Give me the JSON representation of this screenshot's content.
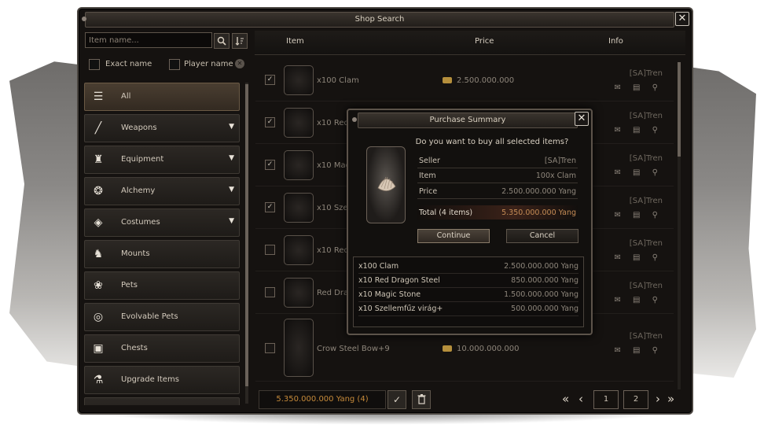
{
  "window": {
    "title": "Shop Search",
    "close_glyph": "✕"
  },
  "search": {
    "placeholder": "Item name...",
    "search_icon": "search-icon",
    "sort_icon": "sort-icon"
  },
  "filters": {
    "exact_name": "Exact name",
    "player_name": "Player name",
    "clear_glyph": "✕"
  },
  "categories": [
    {
      "label": "All",
      "icon": "☰",
      "arrow": "",
      "active": true
    },
    {
      "label": "Weapons",
      "icon": "╱",
      "arrow": "▼"
    },
    {
      "label": "Equipment",
      "icon": "♜",
      "arrow": "▼"
    },
    {
      "label": "Alchemy",
      "icon": "❂",
      "arrow": "▼"
    },
    {
      "label": "Costumes",
      "icon": "◈",
      "arrow": "▼"
    },
    {
      "label": "Mounts",
      "icon": "♞",
      "arrow": ""
    },
    {
      "label": "Pets",
      "icon": "❀",
      "arrow": ""
    },
    {
      "label": "Evolvable Pets",
      "icon": "◎",
      "arrow": ""
    },
    {
      "label": "Chests",
      "icon": "▣",
      "arrow": ""
    },
    {
      "label": "Upgrade Items",
      "icon": "⚗",
      "arrow": ""
    }
  ],
  "columns": {
    "item": "Item",
    "price": "Price",
    "info": "Info"
  },
  "rows": [
    {
      "name": "x100 Clam",
      "price": "2.500.000.000",
      "seller": "[SA]Tren",
      "checked": "✓"
    },
    {
      "name": "x10 Red",
      "price": "",
      "seller": "[SA]Tren",
      "checked": "✓"
    },
    {
      "name": "x10 Mag",
      "price": "",
      "seller": "[SA]Tren",
      "checked": "✓"
    },
    {
      "name": "x10 Szell",
      "price": "",
      "seller": "[SA]Tren",
      "checked": "✓"
    },
    {
      "name": "x10 Red",
      "price": "",
      "seller": "[SA]Tren",
      "checked": ""
    },
    {
      "name": "Red Dra",
      "price": "",
      "seller": "[SA]Tren",
      "checked": ""
    },
    {
      "name": "Crow Steel Bow+9",
      "price": "10.000.000.000",
      "seller": "[SA]Tren",
      "checked": ""
    }
  ],
  "row_info_icons": "✉ ▤ ⚲",
  "footer": {
    "total": "5.350.000.000 Yang (4)",
    "confirm_glyph": "✓",
    "delete_glyph": "🗑",
    "first_glyph": "«",
    "prev_glyph": "‹",
    "pages": [
      "1",
      "2"
    ],
    "next_glyph": "›",
    "last_glyph": "»"
  },
  "dialog": {
    "title": "Purchase Summary",
    "question": "Do you want to buy all selected items?",
    "seller_label": "Seller",
    "seller_value": "[SA]Tren",
    "item_label": "Item",
    "item_value": "100x Clam",
    "price_label": "Price",
    "price_value": "2.500.000.000 Yang",
    "total_label": "Total (4 items)",
    "total_value": "5.350.000.000 Yang",
    "continue": "Continue",
    "cancel": "Cancel",
    "list": [
      {
        "name": "x100 Clam",
        "price": "2.500.000.000 Yang"
      },
      {
        "name": "x10 Red Dragon Steel",
        "price": "850.000.000 Yang"
      },
      {
        "name": "x10 Magic Stone",
        "price": "1.500.000.000 Yang"
      },
      {
        "name": "x10 Szellemfűz virág+",
        "price": "500.000.000 Yang"
      }
    ]
  }
}
